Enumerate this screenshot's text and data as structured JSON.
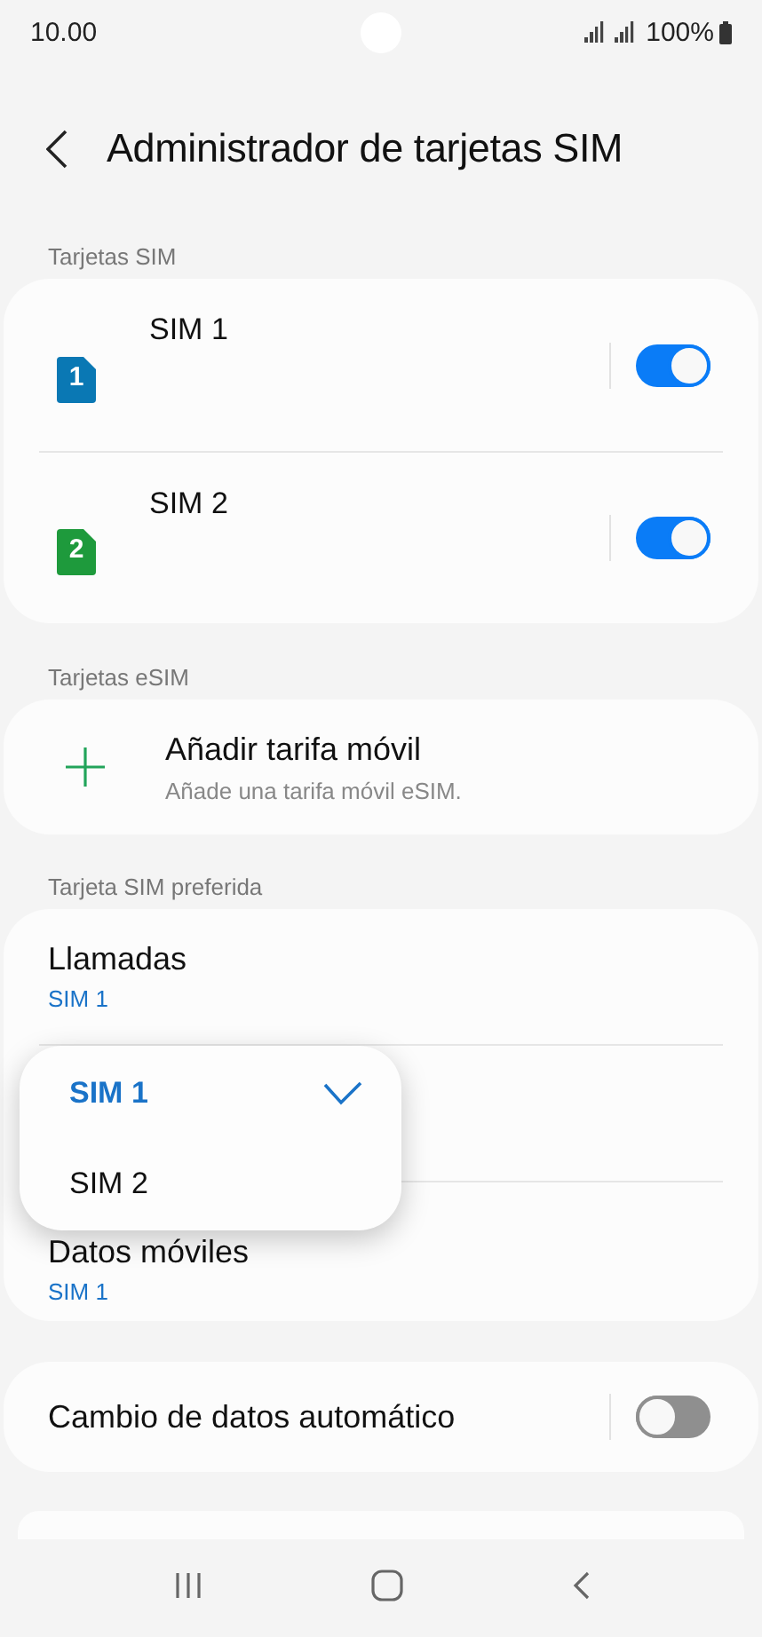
{
  "status_bar": {
    "time": "10.00",
    "battery": "100%"
  },
  "header": {
    "title": "Administrador de tarjetas SIM"
  },
  "sim_section": {
    "label": "Tarjetas SIM",
    "sims": [
      {
        "badge": "1",
        "name": "SIM 1",
        "color": "#0a78b4",
        "on": true
      },
      {
        "badge": "2",
        "name": "SIM 2",
        "color": "#1e9a3c",
        "on": true
      }
    ]
  },
  "esim_section": {
    "label": "Tarjetas eSIM",
    "add": {
      "title": "Añadir tarifa móvil",
      "subtitle": "Añade una tarifa móvil eSIM."
    }
  },
  "preferred_section": {
    "label": "Tarjeta SIM preferida",
    "rows": [
      {
        "title": "Llamadas",
        "value": "SIM 1"
      },
      {
        "title": "Datos móviles",
        "value": "SIM 1"
      }
    ]
  },
  "popup": {
    "options": [
      {
        "label": "SIM 1",
        "selected": true
      },
      {
        "label": "SIM 2",
        "selected": false
      }
    ]
  },
  "auto_switch": {
    "label": "Cambio de datos automático",
    "on": false
  }
}
